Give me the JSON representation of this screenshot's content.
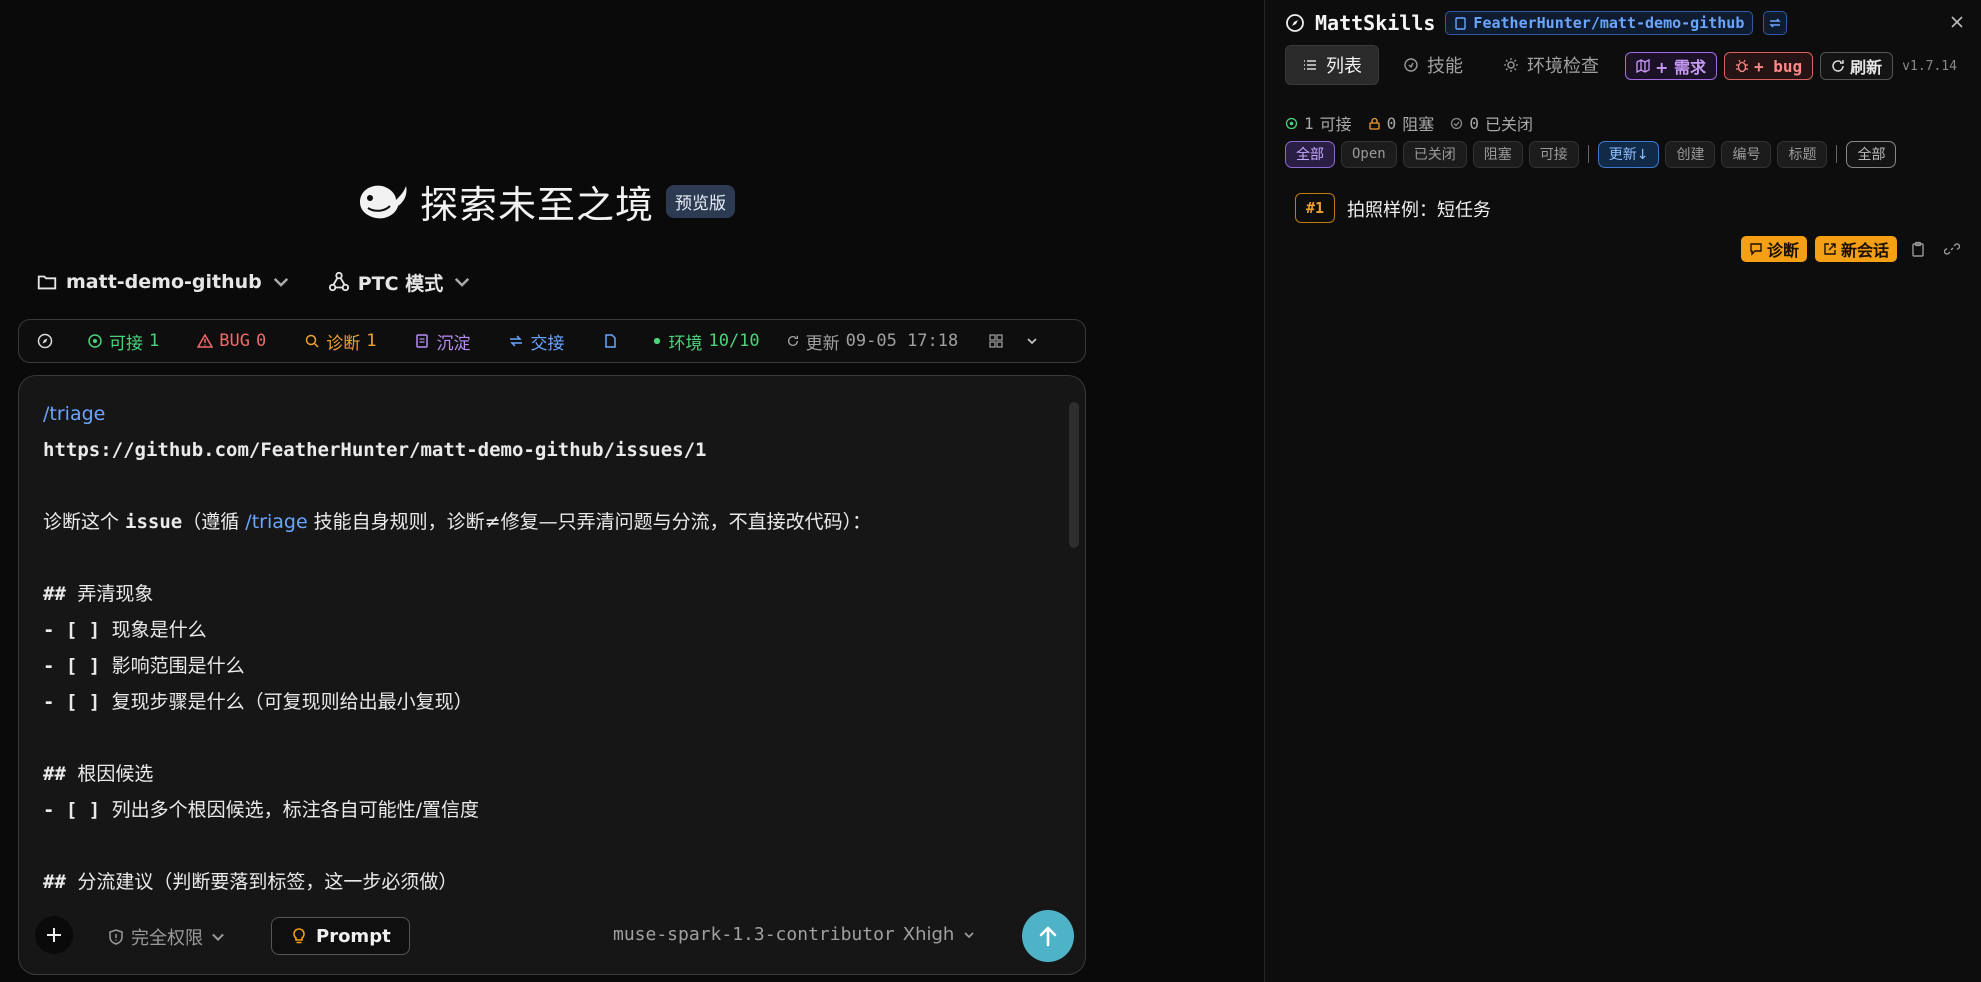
{
  "hero": {
    "title": "探索未至之境",
    "badge": "预览版"
  },
  "context": {
    "project": "matt-demo-github",
    "mode": "PTC 模式"
  },
  "statusbar": {
    "connect_label": "可接",
    "connect_count": "1",
    "bug_label": "BUG",
    "bug_count": "0",
    "diag_label": "诊断",
    "diag_count": "1",
    "settle_label": "沉淀",
    "handoff_label": "交接",
    "env_label": "环境",
    "env_value": "10/10",
    "update_label": "更新",
    "update_time": "09-05 17:18"
  },
  "editor": {
    "lines": [
      {
        "parts": [
          {
            "t": "/triage",
            "c": "cmd"
          }
        ]
      },
      {
        "parts": [
          {
            "t": "https://github.com/FeatherHunter/matt-demo-github/issues/1",
            "c": "url"
          }
        ]
      },
      {
        "parts": [
          {
            "t": "",
            "c": ""
          }
        ]
      },
      {
        "parts": [
          {
            "t": "诊断这个 ",
            "c": ""
          },
          {
            "t": "issue",
            "c": "url"
          },
          {
            "t": "（遵循 ",
            "c": ""
          },
          {
            "t": "/triage",
            "c": "cmd"
          },
          {
            "t": " 技能自身规则，诊断≠修复—只弄清问题与分流，不直接改代码）：",
            "c": ""
          }
        ]
      },
      {
        "parts": [
          {
            "t": "",
            "c": ""
          }
        ]
      },
      {
        "parts": [
          {
            "t": "## ",
            "c": "url"
          },
          {
            "t": "弄清现象",
            "c": ""
          }
        ]
      },
      {
        "parts": [
          {
            "t": "- [ ] ",
            "c": "url"
          },
          {
            "t": "现象是什么",
            "c": ""
          }
        ]
      },
      {
        "parts": [
          {
            "t": "- [ ] ",
            "c": "url"
          },
          {
            "t": "影响范围是什么",
            "c": ""
          }
        ]
      },
      {
        "parts": [
          {
            "t": "- [ ] ",
            "c": "url"
          },
          {
            "t": "复现步骤是什么（可复现则给出最小复现）",
            "c": ""
          }
        ]
      },
      {
        "parts": [
          {
            "t": "",
            "c": ""
          }
        ]
      },
      {
        "parts": [
          {
            "t": "## ",
            "c": "url"
          },
          {
            "t": "根因候选",
            "c": ""
          }
        ]
      },
      {
        "parts": [
          {
            "t": "- [ ] ",
            "c": "url"
          },
          {
            "t": "列出多个根因候选，标注各自可能性/置信度",
            "c": ""
          }
        ]
      },
      {
        "parts": [
          {
            "t": "",
            "c": ""
          }
        ]
      },
      {
        "parts": [
          {
            "t": "## ",
            "c": "url"
          },
          {
            "t": "分流建议（判断要落到标签，这一步必须做）",
            "c": ""
          }
        ]
      }
    ],
    "permission": "完全权限",
    "prompt_label": "Prompt",
    "model": "muse-spark-1.3-contributor",
    "effort": "Xhigh"
  },
  "panel": {
    "brand": "MattSkills",
    "repo": "FeatherHunter/matt-demo-github",
    "tabs": [
      {
        "label": "列表",
        "icon": "list-icon"
      },
      {
        "label": "技能",
        "icon": "skill-icon"
      },
      {
        "label": "环境检查",
        "icon": "env-icon"
      }
    ],
    "actions": {
      "req": "+ 需求",
      "bug": "+ bug",
      "refresh": "刷新"
    },
    "version": "v1.7.14",
    "stats": {
      "connect_count": "1",
      "connect_label": "可接",
      "blocked_count": "0",
      "blocked_label": "阻塞",
      "closed_count": "0",
      "closed_label": "已关闭"
    },
    "filters_status": [
      "全部",
      "Open",
      "已关闭",
      "阻塞",
      "可接"
    ],
    "filters_sort": [
      "更新↓",
      "创建",
      "编号",
      "标题"
    ],
    "filter_extra": "全部",
    "issues": [
      {
        "num": "#1",
        "title": "拍照样例：短任务",
        "diag_label": "诊断",
        "new_label": "新会话"
      }
    ]
  },
  "colors": {
    "accent": "#4fb3c8",
    "orange": "#f5a014",
    "link": "#6aa6ff"
  }
}
